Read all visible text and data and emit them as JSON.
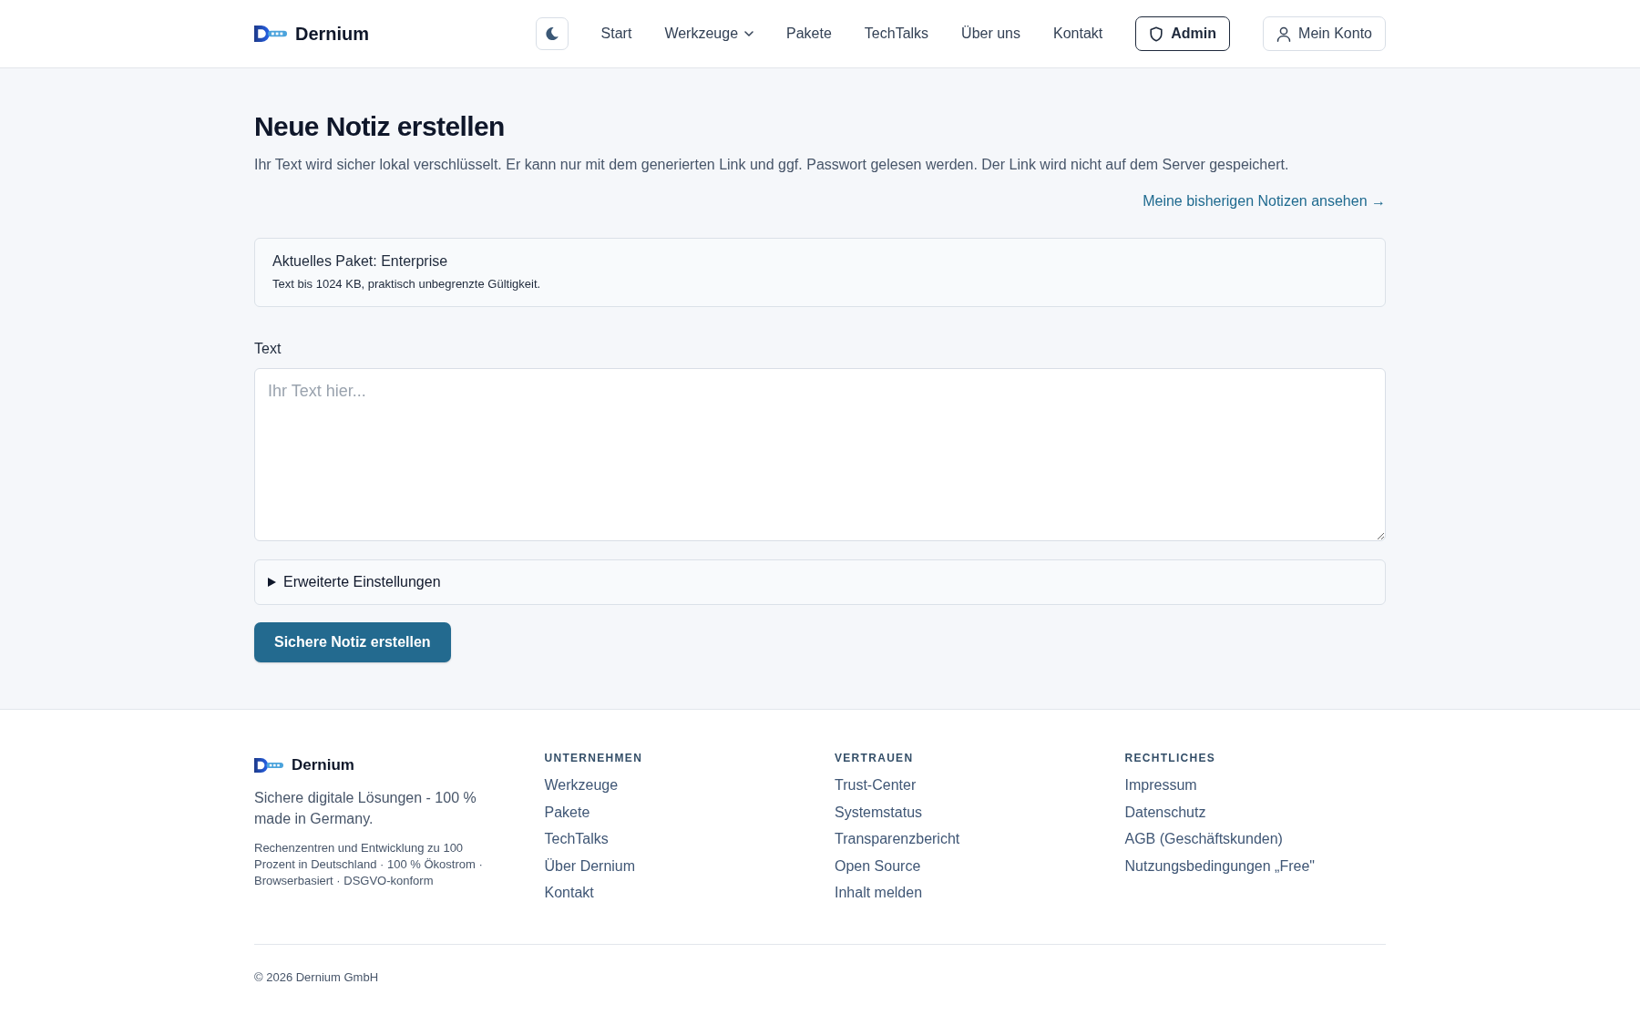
{
  "header": {
    "brand": "Dernium",
    "nav": [
      {
        "label": "Start",
        "kind": "link"
      },
      {
        "label": "Werkzeuge",
        "kind": "dropdown"
      },
      {
        "label": "Pakete",
        "kind": "link"
      },
      {
        "label": "TechTalks",
        "kind": "link"
      },
      {
        "label": "Über uns",
        "kind": "link"
      },
      {
        "label": "Kontakt",
        "kind": "link"
      }
    ],
    "actions": [
      {
        "label": "Admin",
        "kind": "admin"
      },
      {
        "label": "Mein Konto",
        "kind": "account"
      }
    ]
  },
  "intro": {
    "title": "Neue Notiz erstellen",
    "description": "Ihr Text wird sicher lokal verschlüsselt. Er kann nur mit dem generierten Link und ggf. Passwort gelesen werden. Der Link wird nicht auf dem Server gespeichert.",
    "notes_link": "Meine bisherigen Notizen ansehen →"
  },
  "package_card": {
    "title": "Aktuelles Paket: Enterprise",
    "description": "Text bis 1024 KB, praktisch unbegrenzte Gültigkeit."
  },
  "text_field": {
    "label": "Text",
    "placeholder": "Ihr Text hier..."
  },
  "advanced_settings": {
    "label": "Erweiterte Einstellungen",
    "expanded": false
  },
  "submit_button": {
    "label": "Sichere Notiz erstellen"
  },
  "footer": {
    "brand": "Dernium",
    "tagline": "Sichere digitale Lösungen - 100 % made in Germany.",
    "details": "Rechenzentren und Entwicklung zu 100 Prozent in Deutschland · 100 % Ökostrom · Browserbasiert · DSGVO-konform",
    "columns": [
      {
        "heading": "UNTERNEHMEN",
        "links": [
          "Werkzeuge",
          "Pakete",
          "TechTalks",
          "Über Dernium",
          "Kontakt"
        ]
      },
      {
        "heading": "VERTRAUEN",
        "links": [
          "Trust-Center",
          "Systemstatus",
          "Transparenzbericht",
          "Open Source",
          "Inhalt melden"
        ]
      },
      {
        "heading": "RECHTLICHES",
        "links": [
          "Impressum",
          "Datenschutz",
          "AGB (Geschäftskunden)",
          "Nutzungsbedingungen „Free\""
        ]
      }
    ],
    "copyright": "© 2026 Dernium GmbH"
  }
}
